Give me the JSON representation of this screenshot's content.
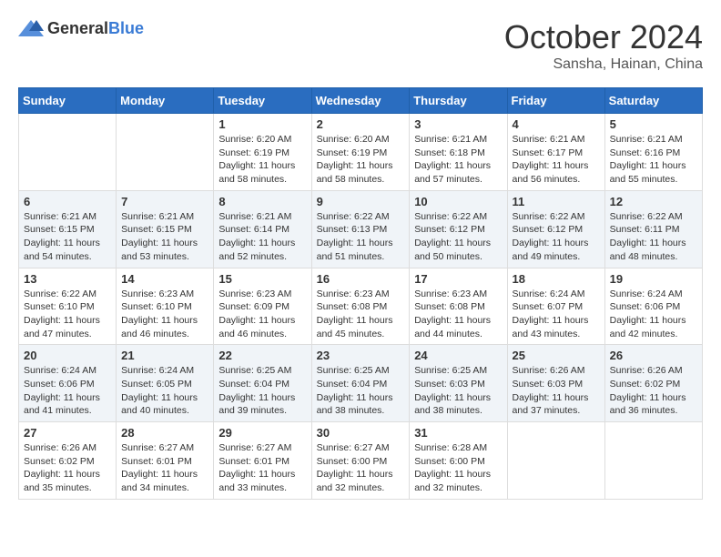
{
  "logo": {
    "general": "General",
    "blue": "Blue"
  },
  "title": {
    "month_year": "October 2024",
    "location": "Sansha, Hainan, China"
  },
  "days_of_week": [
    "Sunday",
    "Monday",
    "Tuesday",
    "Wednesday",
    "Thursday",
    "Friday",
    "Saturday"
  ],
  "weeks": [
    [
      {
        "day": "",
        "sunrise": "",
        "sunset": "",
        "daylight": ""
      },
      {
        "day": "",
        "sunrise": "",
        "sunset": "",
        "daylight": ""
      },
      {
        "day": "1",
        "sunrise": "Sunrise: 6:20 AM",
        "sunset": "Sunset: 6:19 PM",
        "daylight": "Daylight: 11 hours and 58 minutes."
      },
      {
        "day": "2",
        "sunrise": "Sunrise: 6:20 AM",
        "sunset": "Sunset: 6:19 PM",
        "daylight": "Daylight: 11 hours and 58 minutes."
      },
      {
        "day": "3",
        "sunrise": "Sunrise: 6:21 AM",
        "sunset": "Sunset: 6:18 PM",
        "daylight": "Daylight: 11 hours and 57 minutes."
      },
      {
        "day": "4",
        "sunrise": "Sunrise: 6:21 AM",
        "sunset": "Sunset: 6:17 PM",
        "daylight": "Daylight: 11 hours and 56 minutes."
      },
      {
        "day": "5",
        "sunrise": "Sunrise: 6:21 AM",
        "sunset": "Sunset: 6:16 PM",
        "daylight": "Daylight: 11 hours and 55 minutes."
      }
    ],
    [
      {
        "day": "6",
        "sunrise": "Sunrise: 6:21 AM",
        "sunset": "Sunset: 6:15 PM",
        "daylight": "Daylight: 11 hours and 54 minutes."
      },
      {
        "day": "7",
        "sunrise": "Sunrise: 6:21 AM",
        "sunset": "Sunset: 6:15 PM",
        "daylight": "Daylight: 11 hours and 53 minutes."
      },
      {
        "day": "8",
        "sunrise": "Sunrise: 6:21 AM",
        "sunset": "Sunset: 6:14 PM",
        "daylight": "Daylight: 11 hours and 52 minutes."
      },
      {
        "day": "9",
        "sunrise": "Sunrise: 6:22 AM",
        "sunset": "Sunset: 6:13 PM",
        "daylight": "Daylight: 11 hours and 51 minutes."
      },
      {
        "day": "10",
        "sunrise": "Sunrise: 6:22 AM",
        "sunset": "Sunset: 6:12 PM",
        "daylight": "Daylight: 11 hours and 50 minutes."
      },
      {
        "day": "11",
        "sunrise": "Sunrise: 6:22 AM",
        "sunset": "Sunset: 6:12 PM",
        "daylight": "Daylight: 11 hours and 49 minutes."
      },
      {
        "day": "12",
        "sunrise": "Sunrise: 6:22 AM",
        "sunset": "Sunset: 6:11 PM",
        "daylight": "Daylight: 11 hours and 48 minutes."
      }
    ],
    [
      {
        "day": "13",
        "sunrise": "Sunrise: 6:22 AM",
        "sunset": "Sunset: 6:10 PM",
        "daylight": "Daylight: 11 hours and 47 minutes."
      },
      {
        "day": "14",
        "sunrise": "Sunrise: 6:23 AM",
        "sunset": "Sunset: 6:10 PM",
        "daylight": "Daylight: 11 hours and 46 minutes."
      },
      {
        "day": "15",
        "sunrise": "Sunrise: 6:23 AM",
        "sunset": "Sunset: 6:09 PM",
        "daylight": "Daylight: 11 hours and 46 minutes."
      },
      {
        "day": "16",
        "sunrise": "Sunrise: 6:23 AM",
        "sunset": "Sunset: 6:08 PM",
        "daylight": "Daylight: 11 hours and 45 minutes."
      },
      {
        "day": "17",
        "sunrise": "Sunrise: 6:23 AM",
        "sunset": "Sunset: 6:08 PM",
        "daylight": "Daylight: 11 hours and 44 minutes."
      },
      {
        "day": "18",
        "sunrise": "Sunrise: 6:24 AM",
        "sunset": "Sunset: 6:07 PM",
        "daylight": "Daylight: 11 hours and 43 minutes."
      },
      {
        "day": "19",
        "sunrise": "Sunrise: 6:24 AM",
        "sunset": "Sunset: 6:06 PM",
        "daylight": "Daylight: 11 hours and 42 minutes."
      }
    ],
    [
      {
        "day": "20",
        "sunrise": "Sunrise: 6:24 AM",
        "sunset": "Sunset: 6:06 PM",
        "daylight": "Daylight: 11 hours and 41 minutes."
      },
      {
        "day": "21",
        "sunrise": "Sunrise: 6:24 AM",
        "sunset": "Sunset: 6:05 PM",
        "daylight": "Daylight: 11 hours and 40 minutes."
      },
      {
        "day": "22",
        "sunrise": "Sunrise: 6:25 AM",
        "sunset": "Sunset: 6:04 PM",
        "daylight": "Daylight: 11 hours and 39 minutes."
      },
      {
        "day": "23",
        "sunrise": "Sunrise: 6:25 AM",
        "sunset": "Sunset: 6:04 PM",
        "daylight": "Daylight: 11 hours and 38 minutes."
      },
      {
        "day": "24",
        "sunrise": "Sunrise: 6:25 AM",
        "sunset": "Sunset: 6:03 PM",
        "daylight": "Daylight: 11 hours and 38 minutes."
      },
      {
        "day": "25",
        "sunrise": "Sunrise: 6:26 AM",
        "sunset": "Sunset: 6:03 PM",
        "daylight": "Daylight: 11 hours and 37 minutes."
      },
      {
        "day": "26",
        "sunrise": "Sunrise: 6:26 AM",
        "sunset": "Sunset: 6:02 PM",
        "daylight": "Daylight: 11 hours and 36 minutes."
      }
    ],
    [
      {
        "day": "27",
        "sunrise": "Sunrise: 6:26 AM",
        "sunset": "Sunset: 6:02 PM",
        "daylight": "Daylight: 11 hours and 35 minutes."
      },
      {
        "day": "28",
        "sunrise": "Sunrise: 6:27 AM",
        "sunset": "Sunset: 6:01 PM",
        "daylight": "Daylight: 11 hours and 34 minutes."
      },
      {
        "day": "29",
        "sunrise": "Sunrise: 6:27 AM",
        "sunset": "Sunset: 6:01 PM",
        "daylight": "Daylight: 11 hours and 33 minutes."
      },
      {
        "day": "30",
        "sunrise": "Sunrise: 6:27 AM",
        "sunset": "Sunset: 6:00 PM",
        "daylight": "Daylight: 11 hours and 32 minutes."
      },
      {
        "day": "31",
        "sunrise": "Sunrise: 6:28 AM",
        "sunset": "Sunset: 6:00 PM",
        "daylight": "Daylight: 11 hours and 32 minutes."
      },
      {
        "day": "",
        "sunrise": "",
        "sunset": "",
        "daylight": ""
      },
      {
        "day": "",
        "sunrise": "",
        "sunset": "",
        "daylight": ""
      }
    ]
  ]
}
